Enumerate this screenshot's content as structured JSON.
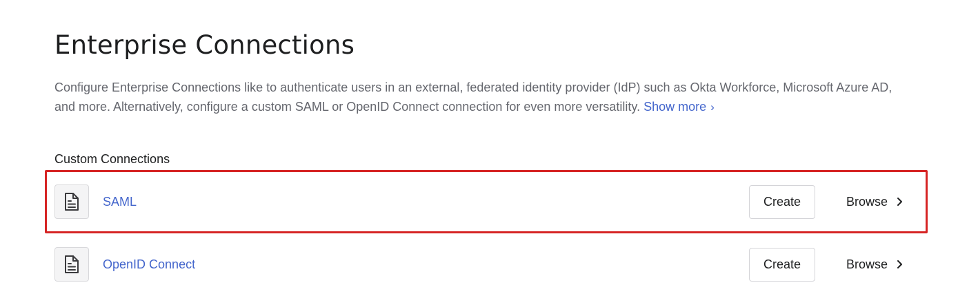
{
  "header": {
    "title": "Enterprise Connections",
    "description": "Configure Enterprise Connections like to authenticate users in an external, federated identity provider (IdP) such as Okta Workforce, Microsoft Azure AD, and more. Alternatively, configure a custom SAML or OpenID Connect connection for even more versatility.",
    "show_more": "Show more"
  },
  "custom_connections": {
    "section_title": "Custom Connections",
    "items": [
      {
        "name": "SAML",
        "create_label": "Create",
        "browse_label": "Browse"
      },
      {
        "name": "OpenID Connect",
        "create_label": "Create",
        "browse_label": "Browse"
      }
    ]
  },
  "colors": {
    "link": "#4466cc",
    "highlight": "#d62424"
  },
  "icons": {
    "connection": "document-icon",
    "chevron": "chevron-right-icon"
  }
}
